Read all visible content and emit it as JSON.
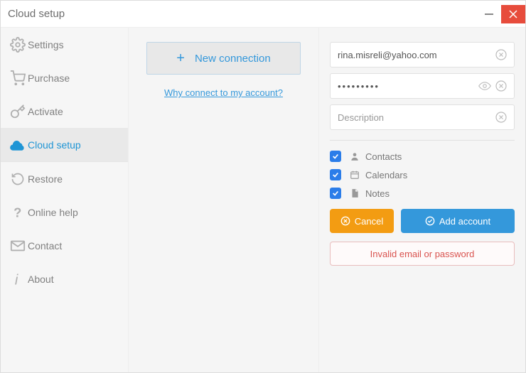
{
  "window": {
    "title": "Cloud setup"
  },
  "sidebar": {
    "items": [
      {
        "label": "Settings"
      },
      {
        "label": "Purchase"
      },
      {
        "label": "Activate"
      },
      {
        "label": "Cloud setup"
      },
      {
        "label": "Restore"
      },
      {
        "label": "Online help"
      },
      {
        "label": "Contact"
      },
      {
        "label": "About"
      }
    ]
  },
  "center": {
    "new_conn_label": "New connection",
    "why_link": "Why connect to my account?"
  },
  "form": {
    "email_value": "rina.misreli@yahoo.com",
    "password_value": "•••••••••",
    "desc_placeholder": "Description",
    "sync": {
      "contacts": "Contacts",
      "calendars": "Calendars",
      "notes": "Notes"
    },
    "cancel_label": "Cancel",
    "add_label": "Add account",
    "error_msg": "Invalid email or password"
  }
}
